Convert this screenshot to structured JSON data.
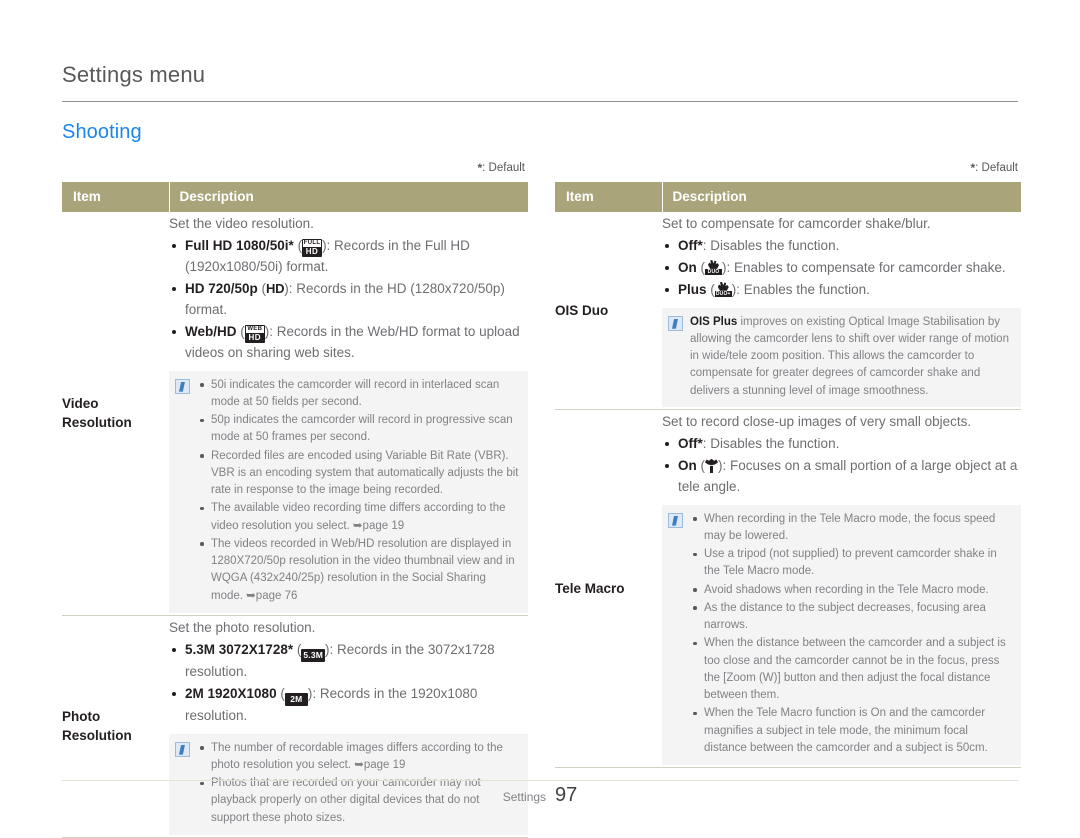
{
  "header": {
    "chapter_title": "Settings menu",
    "section_title": "Shooting"
  },
  "footer": {
    "label": "Settings",
    "page_number": "97"
  },
  "default_note": ": Default",
  "table": {
    "col_item": "Item",
    "col_description": "Description"
  },
  "left": {
    "rows": [
      {
        "item": "Video\nResolution",
        "lead": "Set the video resolution.",
        "options": [
          {
            "name": "Full HD 1080/50i*",
            "icon": "badge-full-hd",
            "icon_top": "FULL",
            "icon_bottom": "HD",
            "text": "): Records in the Full HD (1920x1080/50i) format."
          },
          {
            "name": "HD 720/50p",
            "icon": "badge-hd-text",
            "icon_text": "HD",
            "text": "): Records in the HD (1280x720/50p) format."
          },
          {
            "name": "Web/HD",
            "icon": "badge-web-hd",
            "icon_top": "WEB",
            "icon_bottom": "HD",
            "text": "): Records in the Web/HD format to upload videos on sharing web sites."
          }
        ],
        "notes": [
          "50i indicates the camcorder will record in interlaced scan mode at 50 fields per second.",
          "50p indicates the camcorder will record in progressive scan mode at 50 frames per second.",
          "Recorded files are encoded using Variable Bit Rate (VBR). VBR is an encoding system that automatically adjusts the bit rate in response to the image being recorded.",
          "The available video recording time differs according to the video resolution you select. ➥page 19",
          "The videos recorded in Web/HD resolution are displayed in 1280X720/50p resolution in the video thumbnail view and in WQGA (432x240/25p) resolution in the Social Sharing mode. ➥page 76"
        ]
      },
      {
        "item": "Photo\nResolution",
        "lead": "Set the photo resolution.",
        "options": [
          {
            "name": "5.3M 3072X1728*",
            "icon": "badge-53m",
            "icon_text": "5.3M",
            "text": "): Records in the 3072x1728 resolution."
          },
          {
            "name": "2M 1920X1080",
            "icon": "badge-2m",
            "icon_text": "2M",
            "text": "): Records in the 1920x1080 resolution."
          }
        ],
        "notes": [
          "The number of recordable images differs according to the photo resolution you select. ➥page 19",
          "Photos that are recorded on your camcorder may not playback properly on other digital devices that do not support these photo sizes."
        ]
      }
    ]
  },
  "right": {
    "rows": [
      {
        "item": "OIS Duo",
        "lead": "Set to compensate for camcorder shake/blur.",
        "options": [
          {
            "name": "Off*",
            "icon": "",
            "text": ": Disables the function."
          },
          {
            "name": "On",
            "icon": "badge-ois-duo",
            "icon_text": "DUO",
            "text": "): Enables to compensate for camcorder shake."
          },
          {
            "name": "Plus",
            "icon": "badge-ois-duo-plus",
            "icon_text": "DUO+",
            "text": "): Enables the function."
          }
        ],
        "paragraph_note": {
          "bold": "OIS Plus",
          "text": " improves on existing Optical Image Stabilisation by allowing the camcorder lens to shift over wider range of motion in wide/tele zoom position. This allows the camcorder to compensate for greater degrees of camcorder shake and delivers a stunning level of image smoothness."
        }
      },
      {
        "item": "Tele Macro",
        "lead": "Set to record close-up images of very small objects.",
        "options": [
          {
            "name": "Off*",
            "icon": "",
            "text": ": Disables the function."
          },
          {
            "name": "On",
            "icon": "badge-tulip",
            "text": "): Focuses on a small portion of a large object at a tele angle."
          }
        ],
        "notes": [
          "When recording in the Tele Macro mode, the focus speed may be lowered.",
          "Use a tripod (not supplied) to prevent camcorder shake in the Tele Macro mode.",
          "Avoid shadows when recording in the Tele Macro mode.",
          "As the distance to the subject decreases, focusing area narrows.",
          "When the distance between the camcorder and a subject is too close and the camcorder cannot be in the focus, press the [Zoom (W)] button and then adjust the focal distance between them.",
          "When the Tele Macro function is On and the camcorder magnifies a subject in tele mode, the minimum focal distance between the camcorder and a subject is 50cm."
        ]
      }
    ]
  },
  "colors": {
    "section_accent": "#1a86f0",
    "table_header": "#a9a479",
    "note_bg": "#f4f4f4",
    "body_text": "#6d6e71"
  }
}
